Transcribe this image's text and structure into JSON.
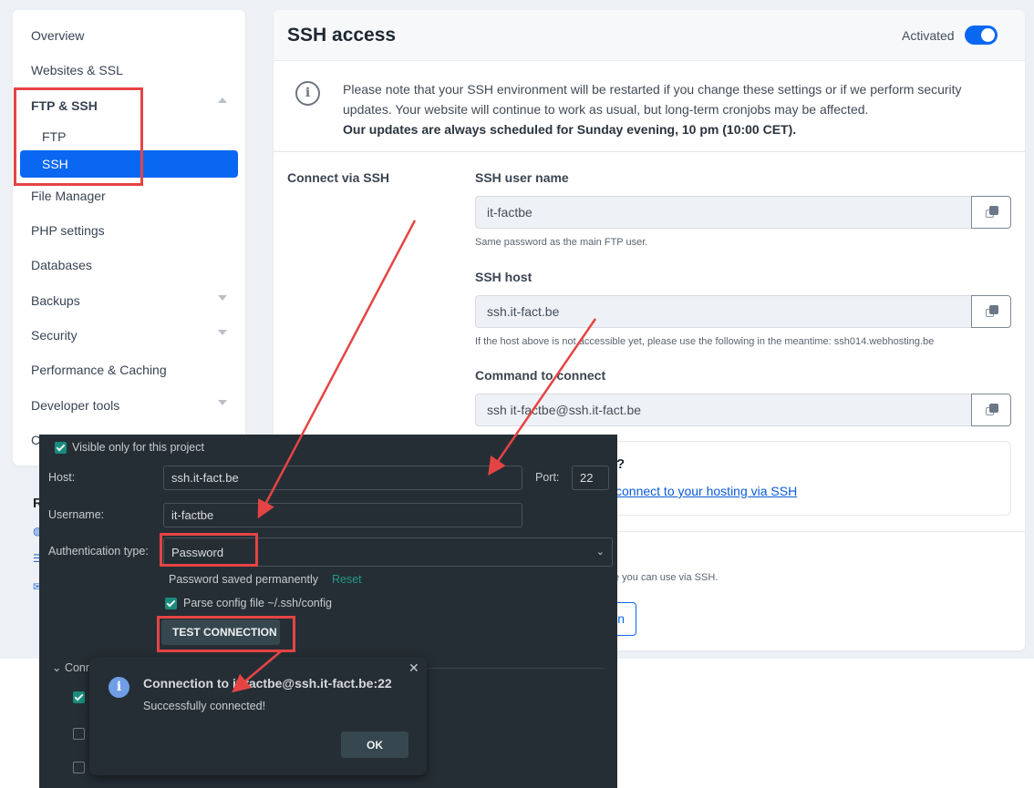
{
  "sidebar": {
    "items": [
      {
        "label": "Overview"
      },
      {
        "label": "Websites & SSL"
      },
      {
        "label": "FTP & SSH",
        "expanded": true
      },
      {
        "label": "FTP"
      },
      {
        "label": "SSH",
        "active": true
      },
      {
        "label": "File Manager"
      },
      {
        "label": "PHP settings"
      },
      {
        "label": "Databases"
      },
      {
        "label": "Backups"
      },
      {
        "label": "Security"
      },
      {
        "label": "Performance & Caching"
      },
      {
        "label": "Developer tools"
      },
      {
        "label": "C"
      }
    ],
    "related_heading_partial": "R"
  },
  "main": {
    "title": "SSH access",
    "toggle_label": "Activated",
    "toggle_on": true,
    "notice": {
      "line1": "Please note that your SSH environment will be restarted if you change these settings or if we perform security updates. Your website will continue to work as usual, but long-term cronjobs may be affected.",
      "bold": "Our updates are always scheduled for Sunday evening, 10 pm (10:00 CET)."
    },
    "section_label": "Connect via SSH",
    "fields": [
      {
        "label": "SSH user name",
        "value": "it-factbe",
        "hint": "Same password as the main FTP user."
      },
      {
        "label": "SSH host",
        "value": "ssh.it-fact.be",
        "hint": "If the host above is not accessible yet, please use the following in the meantime: ssh014.webhosting.be"
      },
      {
        "label": "Command to connect",
        "value": "ssh it-factbe@ssh.it-fact.be"
      }
    ],
    "help_question_partial": "?",
    "help_link_partial": "connect to your hosting via SSH",
    "ssh_note_partial": "e you can use via SSH.",
    "outline_button_partial": "n"
  },
  "ide_dialog": {
    "visible_only_label": "Visible only for this project",
    "visible_only_checked": true,
    "host_label": "Host:",
    "host_value": "ssh.it-fact.be",
    "port_label": "Port:",
    "port_value": "22",
    "username_label": "Username:",
    "username_value": "it-factbe",
    "auth_label": "Authentication type:",
    "auth_value": "Password",
    "password_saved": "Password saved permanently",
    "reset_label": "Reset",
    "parse_config_label": "Parse config file ~/.ssh/config",
    "parse_config_checked": true,
    "test_button": "TEST CONNECTION",
    "connection_section_partial": "Conn"
  },
  "popup": {
    "title": "Connection to it-factbe@ssh.it-fact.be:22",
    "message": "Successfully connected!",
    "ok_label": "OK"
  }
}
